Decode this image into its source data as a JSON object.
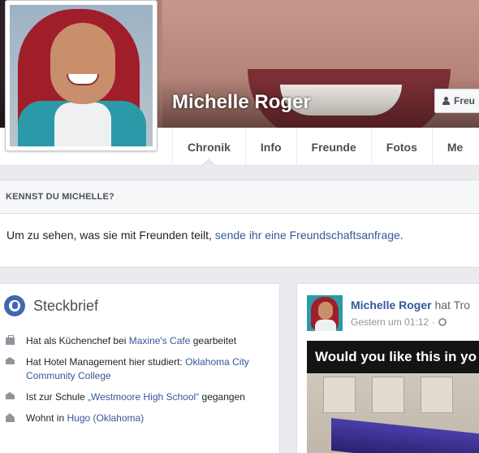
{
  "profile": {
    "name": "Michelle Roger",
    "friend_button_label": "Freu"
  },
  "tabs": [
    {
      "label": "Chronik",
      "active": true
    },
    {
      "label": "Info"
    },
    {
      "label": "Freunde"
    },
    {
      "label": "Fotos"
    },
    {
      "label": "Me"
    }
  ],
  "know": {
    "header": "KENNST DU MICHELLE?",
    "text": "Um zu sehen, was sie mit Freunden teilt, ",
    "link": "sende ihr eine Freundschaftsanfrage",
    "end": "."
  },
  "steckbrief": {
    "title": "Steckbrief",
    "items": [
      {
        "icon": "briefcase-icon",
        "pre": "Hat als Küchenchef bei ",
        "link": "Maxine's Cafe",
        "post": " gearbeitet"
      },
      {
        "icon": "graduation-cap-icon",
        "pre": "Hat Hotel Management hier studiert: ",
        "link": "Oklahoma City Community College",
        "post": ""
      },
      {
        "icon": "graduation-cap-icon",
        "pre": "Ist zur Schule ",
        "link": "„Westmoore High School“",
        "post": " gegangen"
      },
      {
        "icon": "home-icon",
        "pre": "Wohnt in ",
        "link": "Hugo (Oklahoma)",
        "post": ""
      }
    ]
  },
  "post": {
    "author": "Michelle Roger",
    "action": " hat Tro",
    "time": "Gestern um 01:12",
    "separator": "·",
    "privacy_icon": "globe-icon",
    "image_caption": "Would you like this in yo"
  },
  "colors": {
    "link": "#365899",
    "background": "#e9ebee",
    "brand": "#4267b2"
  }
}
